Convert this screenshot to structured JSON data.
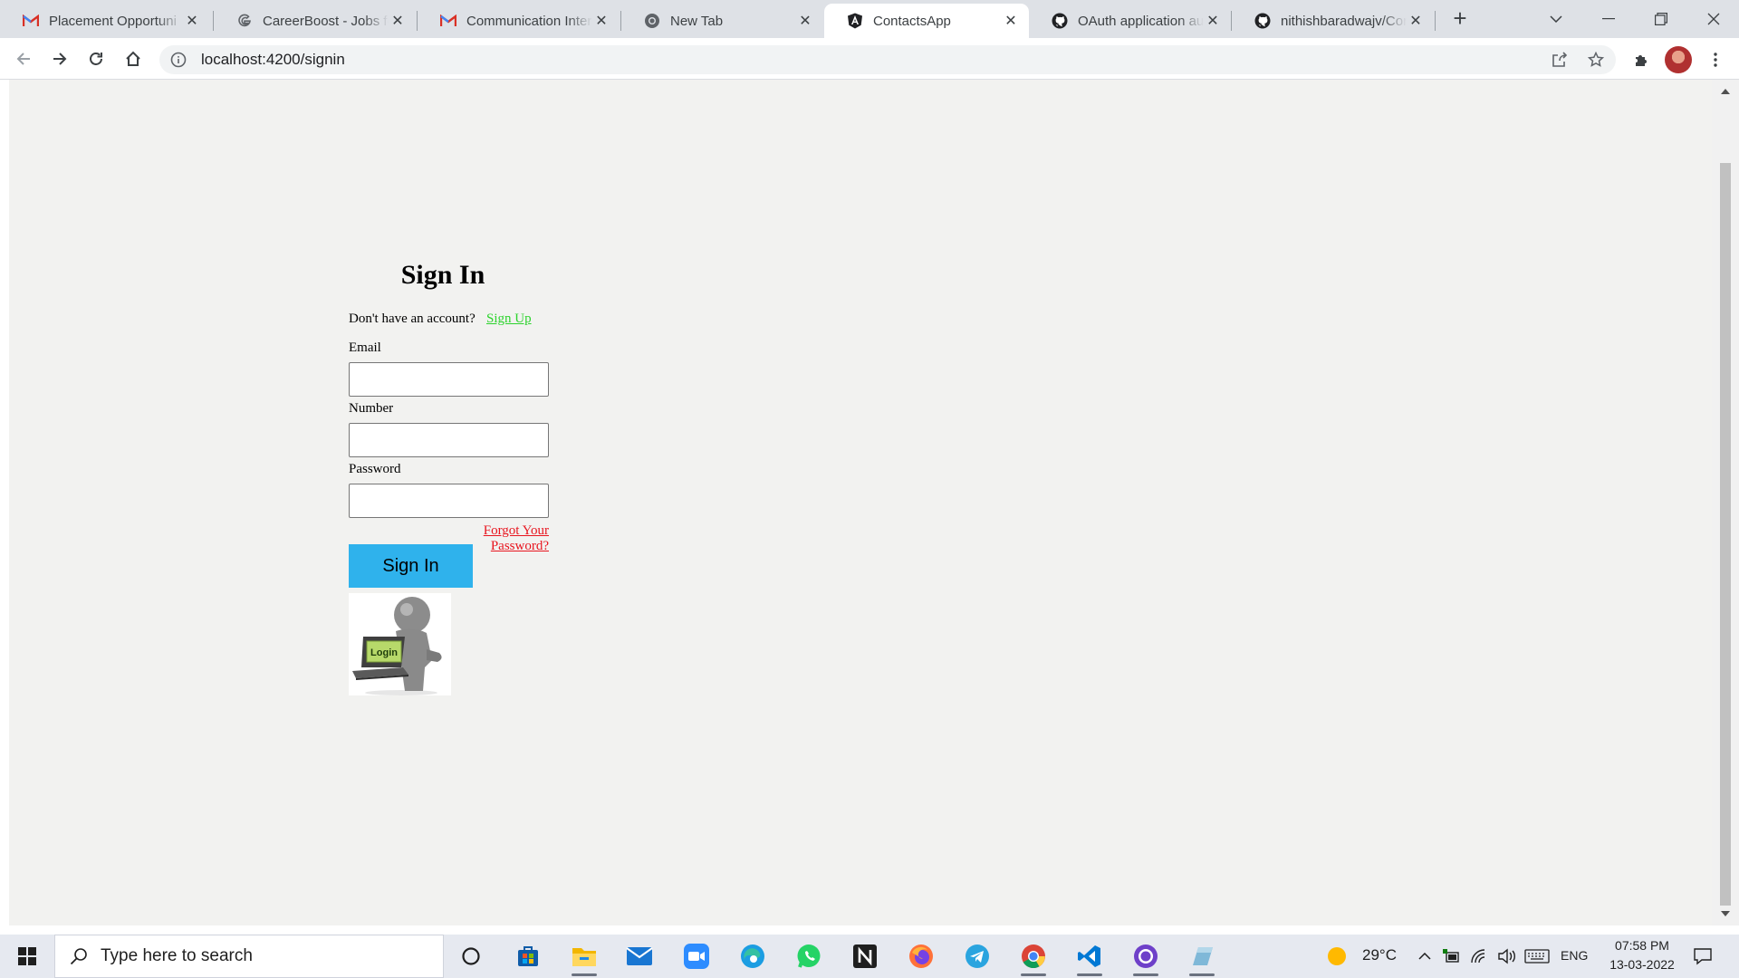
{
  "browser": {
    "tabs": [
      {
        "title": "Placement Opportuni",
        "favicon": "gmail-icon",
        "active": false
      },
      {
        "title": "CareerBoost - Jobs fo",
        "favicon": "google-icon",
        "active": false
      },
      {
        "title": "Communication Inter",
        "favicon": "gmail-icon",
        "active": false
      },
      {
        "title": "New Tab",
        "favicon": "chrome-icon",
        "active": false
      },
      {
        "title": "ContactsApp",
        "favicon": "angular-icon",
        "active": true
      },
      {
        "title": "OAuth application au",
        "favicon": "github-icon",
        "active": false
      },
      {
        "title": "nithishbaradwajv/Con",
        "favicon": "github-icon",
        "active": false
      }
    ],
    "close_glyph": "✕",
    "new_tab_glyph": "+",
    "url": "localhost:4200/signin"
  },
  "page": {
    "heading": "Sign In",
    "no_account_text": "Don't have an account?",
    "signup_link": "Sign Up",
    "email_label": "Email",
    "email_value": "",
    "number_label": "Number",
    "number_value": "",
    "password_label": "Password",
    "password_value": "",
    "forgot_link": "Forgot Your Password?",
    "signin_button": "Sign In",
    "login_image_text": "Login"
  },
  "taskbar": {
    "search_placeholder": "Type here to search",
    "weather": "29°C",
    "language": "ENG",
    "time": "07:58 PM",
    "date": "13-03-2022"
  },
  "colors": {
    "page_background": "#f2f2f0",
    "signup_link": "#2cd32c",
    "forgot_link": "#e8141e",
    "signin_button": "#2fb2ec",
    "tab_strip": "#dee1e6"
  }
}
